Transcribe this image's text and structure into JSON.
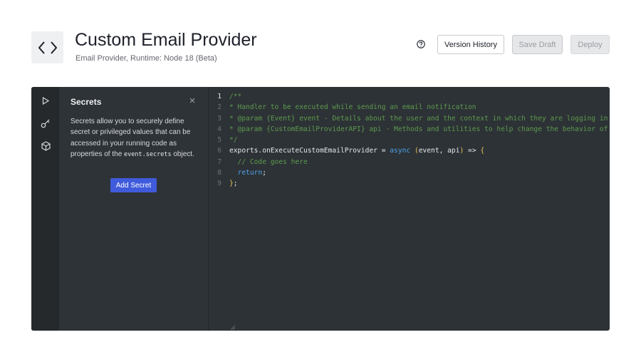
{
  "header": {
    "title": "Custom Email Provider",
    "subtitle": "Email Provider, Runtime: Node 18 (Beta)",
    "logo_icon": "code-brackets-icon",
    "help_icon": "question-circle-icon"
  },
  "toolbar": {
    "version_history_label": "Version History",
    "save_draft_label": "Save Draft",
    "deploy_label": "Deploy"
  },
  "sidebar": {
    "icons": [
      "play-icon",
      "key-icon",
      "package-icon"
    ]
  },
  "secrets_panel": {
    "title": "Secrets",
    "description_before": "Secrets allow you to securely define secret or privileged values that can be accessed in your running code as properties of the ",
    "description_code": "event.secrets",
    "description_after": " object.",
    "add_button_label": "Add Secret"
  },
  "code": {
    "active_line": 1,
    "lines": [
      {
        "n": "1",
        "parts": [
          {
            "t": "/**",
            "c": "comment"
          }
        ]
      },
      {
        "n": "2",
        "parts": [
          {
            "t": "* Handler to be executed while sending an email notification",
            "c": "comment"
          }
        ]
      },
      {
        "n": "3",
        "parts": [
          {
            "t": "* @param {Event} event - Details about the user and the context in which they are logging in.",
            "c": "comment"
          }
        ]
      },
      {
        "n": "4",
        "parts": [
          {
            "t": "* @param {CustomEmailProviderAPI} api - Methods and utilities to help change the behavior of sending a email notification.",
            "c": "comment"
          }
        ]
      },
      {
        "n": "5",
        "parts": [
          {
            "t": "*/",
            "c": "comment"
          }
        ]
      },
      {
        "n": "6",
        "parts": [
          {
            "t": "exports.onExecuteCustomEmailProvider = ",
            "c": "plain"
          },
          {
            "t": "async",
            "c": "kw"
          },
          {
            "t": " ",
            "c": "plain"
          },
          {
            "t": "(",
            "c": "paren"
          },
          {
            "t": "event, api",
            "c": "plain"
          },
          {
            "t": ")",
            "c": "paren"
          },
          {
            "t": " => ",
            "c": "plain"
          },
          {
            "t": "{",
            "c": "paren"
          }
        ]
      },
      {
        "n": "7",
        "parts": [
          {
            "t": "  // Code goes here",
            "c": "comment"
          }
        ]
      },
      {
        "n": "8",
        "parts": [
          {
            "t": "  ",
            "c": "plain"
          },
          {
            "t": "return",
            "c": "kw"
          },
          {
            "t": ";",
            "c": "plain"
          }
        ]
      },
      {
        "n": "9",
        "parts": [
          {
            "t": "}",
            "c": "paren"
          },
          {
            "t": ";",
            "c": "plain"
          }
        ]
      }
    ]
  },
  "colors": {
    "accent": "#3f5bdb",
    "editor_bg": "#2d3236",
    "comment": "#5c9a4d",
    "keyword": "#4ea1e8"
  }
}
